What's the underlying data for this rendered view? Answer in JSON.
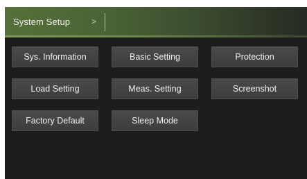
{
  "header": {
    "title": "System Setup",
    "separator": ">",
    "accent_color": "#5c7a3e"
  },
  "buttons": [
    {
      "label": "Sys. Information"
    },
    {
      "label": "Basic Setting"
    },
    {
      "label": "Protection"
    },
    {
      "label": "Load Setting"
    },
    {
      "label": "Meas. Setting"
    },
    {
      "label": "Screenshot"
    },
    {
      "label": "Factory Default"
    },
    {
      "label": "Sleep Mode"
    }
  ]
}
